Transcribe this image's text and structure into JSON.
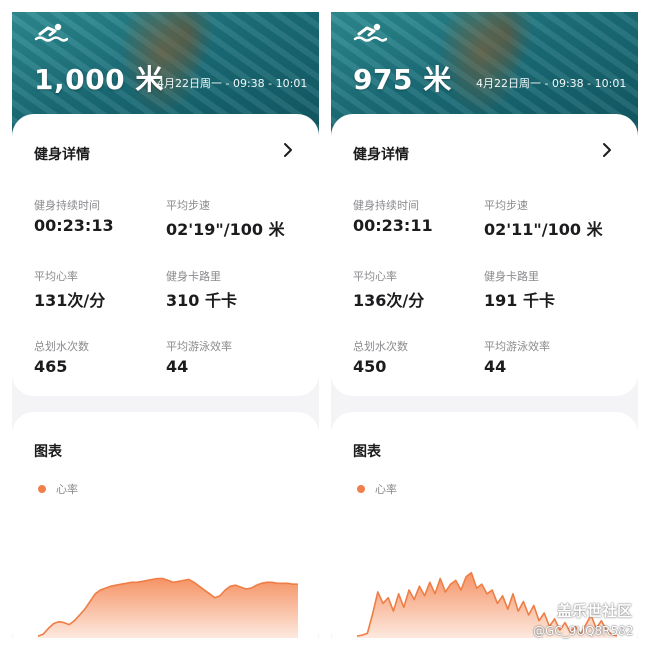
{
  "colors": {
    "accent": "#f0804a",
    "chart_fill_top": "#f59466",
    "chart_fill_bottom": "#fde9df",
    "chart_line": "#ef7d45"
  },
  "icons": {
    "activity": "swimmer-icon",
    "details_more": "chevron-right-icon",
    "legend": "dot-icon"
  },
  "panels": [
    {
      "header": {
        "distance": "1,000 米",
        "time_range": "4月22日周一 - 09:38 - 10:01"
      },
      "details": {
        "title": "健身详情",
        "metrics": [
          {
            "label": "健身持续时间",
            "value": "00:23:13"
          },
          {
            "label": "平均步速",
            "value": "02'19\"/100 米"
          },
          {
            "label": "平均心率",
            "value": "131次/分"
          },
          {
            "label": "健身卡路里",
            "value": "310 千卡"
          },
          {
            "label": "总划水次数",
            "value": "465"
          },
          {
            "label": "平均游泳效率",
            "value": "44"
          }
        ]
      },
      "chart": {
        "title": "图表",
        "legend": "心率"
      }
    },
    {
      "header": {
        "distance": "975 米",
        "time_range": "4月22日周一 - 09:38 - 10:01"
      },
      "details": {
        "title": "健身详情",
        "metrics": [
          {
            "label": "健身持续时间",
            "value": "00:23:11"
          },
          {
            "label": "平均步速",
            "value": "02'11\"/100 米"
          },
          {
            "label": "平均心率",
            "value": "136次/分"
          },
          {
            "label": "健身卡路里",
            "value": "191 千卡"
          },
          {
            "label": "总划水次数",
            "value": "450"
          },
          {
            "label": "平均游泳效率",
            "value": "44"
          }
        ]
      },
      "chart": {
        "title": "图表",
        "legend": "心率"
      }
    }
  ],
  "chart_data": [
    {
      "type": "area",
      "series": [
        {
          "name": "心率",
          "values": [
            2,
            4,
            10,
            15,
            17,
            16,
            14,
            18,
            24,
            30,
            38,
            46,
            50,
            52,
            54,
            55,
            56,
            57,
            58,
            58,
            59,
            60,
            61,
            62,
            62,
            60,
            58,
            59,
            60,
            61,
            58,
            54,
            50,
            46,
            42,
            44,
            50,
            54,
            55,
            53,
            51,
            52,
            55,
            57,
            58,
            58,
            57,
            57,
            57,
            56,
            56
          ]
        }
      ],
      "y_scale_max": 100
    },
    {
      "type": "area",
      "series": [
        {
          "name": "心率",
          "values": [
            2,
            3,
            5,
            25,
            48,
            36,
            42,
            28,
            46,
            32,
            50,
            40,
            54,
            44,
            58,
            46,
            62,
            48,
            56,
            60,
            50,
            64,
            68,
            52,
            56,
            46,
            50,
            36,
            44,
            30,
            46,
            28,
            38,
            24,
            34,
            18,
            26,
            12,
            20,
            8,
            16,
            6,
            12,
            4,
            14,
            24,
            10,
            18,
            8,
            4,
            2
          ]
        }
      ],
      "y_scale_max": 100
    }
  ],
  "watermark": {
    "brand": "盖乐世社区",
    "user": "@GC_9UQ8R582"
  }
}
